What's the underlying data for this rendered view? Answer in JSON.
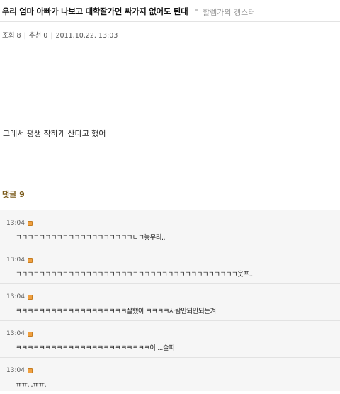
{
  "post": {
    "title": "우리 엄마 아빠가 나보고 대학잘가면 싸가지 없어도 된대",
    "gallery": "할렘가의 갱스터",
    "views": "조회 8",
    "likes": "추천 0",
    "date": "2011.10.22. 13:03",
    "body": "그래서 평생 착하게 산다고 했어"
  },
  "comment_header": "댓글 9",
  "comments": [
    {
      "time": "13:04",
      "text": "ㅋㅋㅋㅋㅋㅋㅋㅋㅋㅋㅋㅋㅋㅋㅋㅋㅋㅋㅋㅋㄴㅋ놓무리.."
    },
    {
      "time": "13:04",
      "text": "ㅋㅋㅋㅋㅋㅋㅋㅋㅋㅋㅋㅋㅋㅋㅋㅋㅋㅋㅋㅋㅋㅋㅋㅋㅋㅋㅋㅋㅋㅋㅋㅋㅋㅋㅋㅋㅋㅋ웃프.."
    },
    {
      "time": "13:04",
      "text": "ㅋㅋㅋㅋㅋㅋㅋㅋㅋㅋㅋㅋㅋㅋㅋㅋㅋㅋㅋ잘했아 ㅋㅋㅋㅋ사람만되만되는겨"
    },
    {
      "time": "13:04",
      "text": "ㅋㅋㅋㅋㅋㅋㅋㅋㅋㅋㅋㅋㅋㅋㅋㅋㅋㅋㅋㅋㅋㅋㅋ아 ...슬퍼"
    },
    {
      "time": "13:04",
      "text": "ㅠㅠ...ㅠㅠ.."
    }
  ],
  "colors": {
    "comment_header": "#7a5a1a",
    "comment_bg": "#f6f6f6",
    "icon": "#f0a040"
  }
}
